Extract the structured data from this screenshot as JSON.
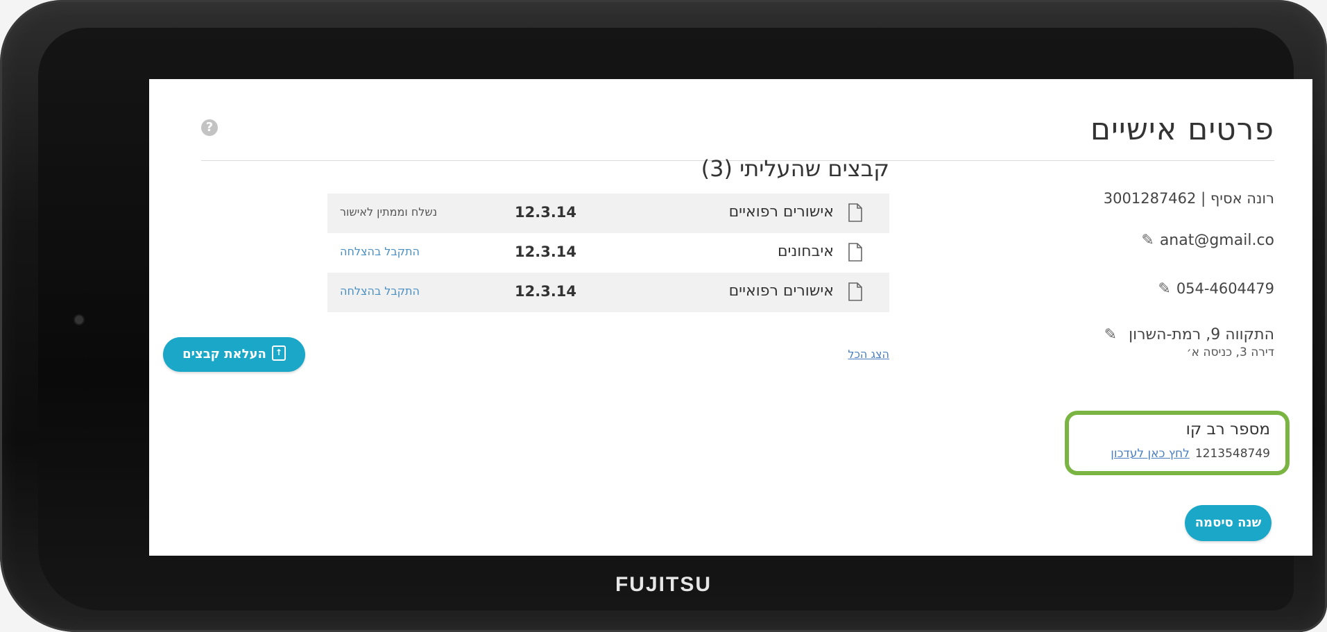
{
  "device": {
    "brand": "FUJITSU"
  },
  "page": {
    "title": "פרטים אישיים",
    "help_icon": "?"
  },
  "profile": {
    "name_id": "רונה אסיף | 3001287462",
    "email": "anat@gmail.co",
    "phone": "054-4604479",
    "address_line1": "התקווה 9, רמת-השרון",
    "address_line2": "דירה 3, כניסה א׳",
    "multiline_label": "מספר רב קו",
    "multiline_number": "1213548749",
    "multiline_update_link": "לחץ כאן לעדכון",
    "change_password_label": "שנה סיסמה"
  },
  "files": {
    "title": "קבצים שהעליתי (3)",
    "rows": [
      {
        "name": "אישורים רפואיים",
        "date": "12.3.14",
        "status": "נשלח וממתין לאישור",
        "status_type": "pending"
      },
      {
        "name": "איבחונים",
        "date": "12.3.14",
        "status": "התקבל בהצלחה",
        "status_type": "ok"
      },
      {
        "name": "אישורים רפואיים",
        "date": "12.3.14",
        "status": "התקבל בהצלחה",
        "status_type": "ok"
      }
    ],
    "show_all_label": "הצג הכל",
    "upload_label": "העלאת קבצים"
  },
  "colors": {
    "accent": "#1aa7c8",
    "highlight_box": "#7ab442",
    "link": "#4a7fc1"
  }
}
